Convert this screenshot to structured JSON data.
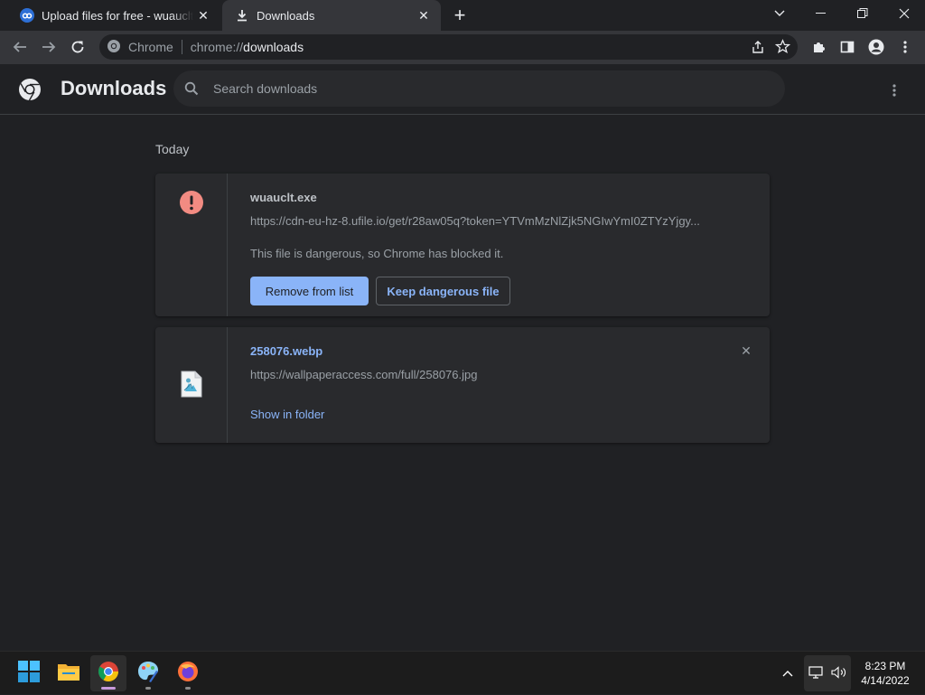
{
  "tabs": [
    {
      "title": "Upload files for free - wuauclt.exe - ufile.io",
      "icon": "ufile-favicon"
    },
    {
      "title": "Downloads",
      "icon": "download-icon"
    }
  ],
  "omnibox": {
    "chip_label": "Chrome",
    "scheme": "chrome://",
    "host": "downloads"
  },
  "page": {
    "title": "Downloads",
    "search_placeholder": "Search downloads"
  },
  "section": "Today",
  "items": [
    {
      "name": "wuauclt.exe",
      "url": "https://cdn-eu-hz-8.ufile.io/get/r28aw05q?token=YTVmMzNlZjk5NGIwYmI0ZTYzYjgy...",
      "warning": "This file is dangerous, so Chrome has blocked it.",
      "primary_action": "Remove from list",
      "secondary_action": "Keep dangerous file",
      "icon": "danger-icon",
      "status_color": "#f28b82"
    },
    {
      "name": "258076.webp",
      "url": "https://wallpaperaccess.com/full/258076.jpg",
      "action": "Show in folder",
      "icon": "image-file-icon"
    }
  ],
  "taskbar": {
    "apps": [
      "start",
      "file-explorer",
      "chrome",
      "paint",
      "firefox"
    ],
    "time": "8:23 PM",
    "date": "4/14/2022"
  }
}
